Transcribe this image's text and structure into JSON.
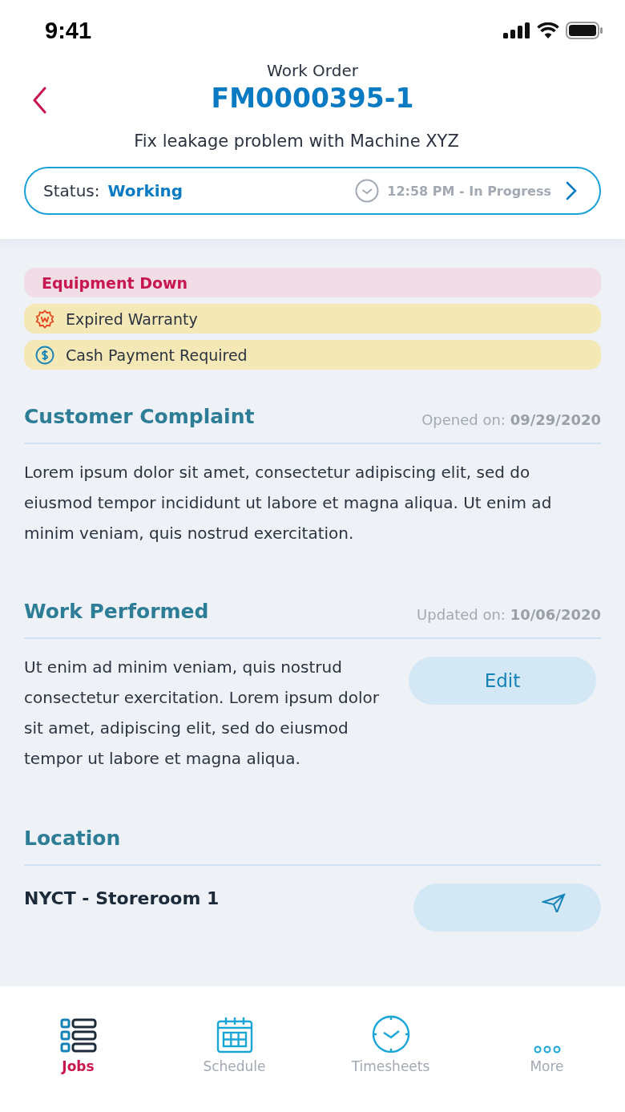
{
  "status_bar": {
    "time": "9:41"
  },
  "header": {
    "caption": "Work Order",
    "title": "FM0000395-1",
    "subtitle": "Fix leakage problem with Machine XYZ"
  },
  "status": {
    "label": "Status:",
    "value": "Working",
    "time": "12:58 PM - In Progress"
  },
  "tags": [
    {
      "kind": "alert",
      "label": "Equipment Down"
    },
    {
      "kind": "warranty",
      "label": "Expired Warranty"
    },
    {
      "kind": "payment",
      "label": "Cash Payment Required"
    }
  ],
  "complaint": {
    "title": "Customer Complaint",
    "meta_label": "Opened on:",
    "meta_value": "09/29/2020",
    "text": "Lorem ipsum dolor sit amet, consectetur adipiscing elit, sed do eiusmod tempor incididunt ut labore et magna aliqua. Ut enim ad minim veniam, quis nostrud exercitation."
  },
  "work": {
    "title": "Work Performed",
    "meta_label": "Updated on:",
    "meta_value": "10/06/2020",
    "text": "Ut enim ad minim veniam, quis nostrud consectetur exercitation. Lorem ipsum dolor sit amet,  adipiscing elit, sed do eiusmod tempor ut labore et magna aliqua.",
    "button": "Edit"
  },
  "location": {
    "title": "Location",
    "name": "NYCT - Storeroom 1"
  },
  "tab_bar": [
    {
      "kind": "jobs",
      "label": "Jobs",
      "selected": true
    },
    {
      "kind": "schedule",
      "label": "Schedule",
      "selected": false
    },
    {
      "kind": "timesheets",
      "label": "Timesheets",
      "selected": false
    },
    {
      "kind": "more",
      "label": "More",
      "selected": false
    }
  ]
}
